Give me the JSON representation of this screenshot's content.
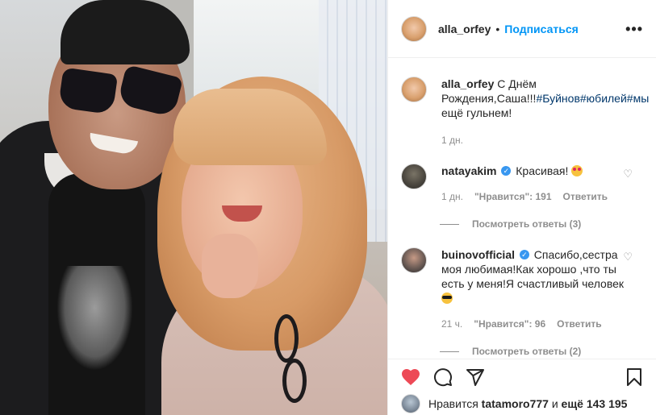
{
  "post": {
    "author": "alla_orfey",
    "follow_label": "Подписаться",
    "dot": "•",
    "more_label": "•••"
  },
  "caption": {
    "user": "alla_orfey",
    "text_before": "С Днём Рождения,Саша!!!",
    "tag1": "#Буйнов",
    "tag2": "#юбилей",
    "tag3": "#мы",
    "text_after": "ещё гульнем!",
    "time": "1 дн."
  },
  "comments": [
    {
      "user": "natayakim",
      "text": "Красивая!",
      "time": "1 дн.",
      "likes": "\"Нравится\": 191",
      "reply": "Ответить",
      "view_replies": "Посмотреть ответы (3)"
    },
    {
      "user": "buinovofficial",
      "text": "Спасибо,сестра моя любимая!Как хорошо ,что ты есть у меня!Я счастливый человек",
      "time": "21 ч.",
      "likes": "\"Нравится\": 96",
      "reply": "Ответить",
      "view_replies": "Посмотреть ответы (2)"
    }
  ],
  "likes_bar": {
    "prefix": "Нравится",
    "user": "tatamoro777",
    "and": "и",
    "count": "ещё 143 195"
  },
  "colors": {
    "accent": "#0095f6",
    "heart": "#ed4956",
    "verified": "#3897f0"
  }
}
